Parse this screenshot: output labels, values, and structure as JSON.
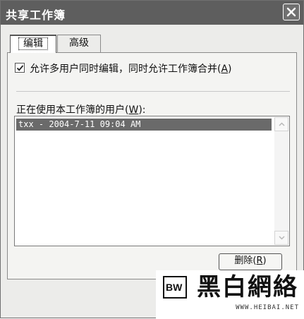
{
  "window": {
    "title": "共享工作簿"
  },
  "tabs": [
    {
      "label": "编辑"
    },
    {
      "label": "高级"
    }
  ],
  "edit_tab": {
    "allow_multiuser": {
      "checked": true,
      "label_before": "允许多用户同时编辑，同时允许工作簿合并",
      "mnemonic_open": "(",
      "mnemonic": "A",
      "mnemonic_close": ")"
    },
    "users_list": {
      "label_before": "正在使用本工作簿的用户",
      "mnemonic_open": "(",
      "mnemonic": "W",
      "mnemonic_close": "):",
      "items": [
        "txx - 2004-7-11 09:04 AM"
      ]
    },
    "remove_button": {
      "label_before": "删除",
      "mnemonic_open": "(",
      "mnemonic": "R",
      "mnemonic_close": ")"
    }
  },
  "watermark": {
    "logo_letters": "BW",
    "brand": "黑白網絡",
    "url": "WWW.HEIBAI.NET"
  },
  "icons": {
    "close": "close-icon",
    "check": "check-icon",
    "scroll_up": "chevron-up-icon",
    "scroll_down": "chevron-down-icon"
  }
}
